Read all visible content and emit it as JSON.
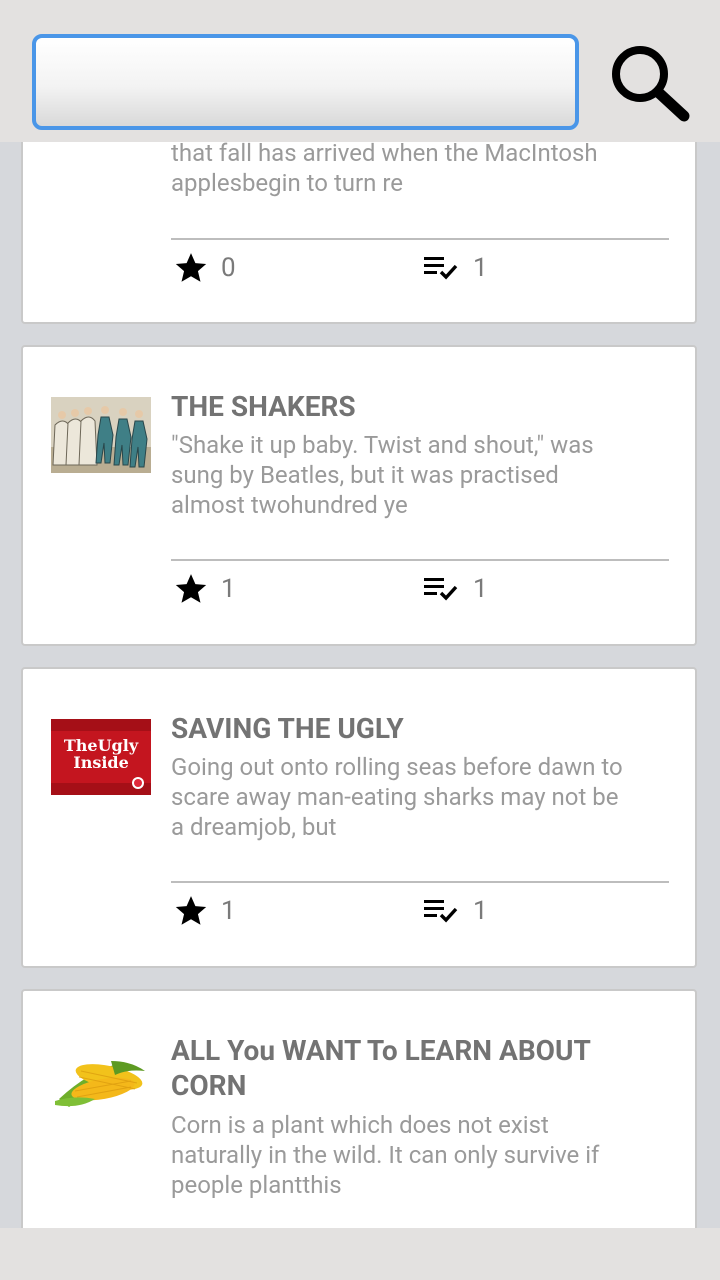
{
  "search": {
    "placeholder": "",
    "value": ""
  },
  "articles": [
    {
      "title": "",
      "description_line1": "that fall has arrived when the MacIntosh",
      "description_line2": "applesbegin to turn re",
      "description_line3": "",
      "stars": "0",
      "checks": "1"
    },
    {
      "title": "THE SHAKERS",
      "thumbnail": "shakers-engraving-image",
      "description_line1": "\"Shake it up baby. Twist and shout,\" was",
      "description_line2": "sung by Beatles, but it was practised",
      "description_line3": "almost twohundred ye",
      "stars": "1",
      "checks": "1"
    },
    {
      "title": "SAVING THE UGLY",
      "thumbnail": "the-ugly-inside-image",
      "thumb_text_1": "TheUgly",
      "thumb_text_2": "Inside",
      "description_line1": "Going out onto rolling seas before dawn to",
      "description_line2": "scare away man-eating sharks may not be",
      "description_line3": "a dreamjob, but",
      "stars": "1",
      "checks": "1"
    },
    {
      "title_line1": "ALL You WANT To LEARN ABOUT",
      "title_line2": "CORN",
      "thumbnail": "corn-cobs-image",
      "description_line1": "Corn is a plant which does not exist",
      "description_line2": "naturally in the wild. It can only survive if",
      "description_line3": "people plantthis"
    }
  ],
  "icons": {
    "star": "star-icon",
    "checklist": "checklist-icon",
    "search": "search-icon"
  },
  "colors": {
    "accent": "#4a96e8",
    "title": "#737373",
    "description": "#9a9a9a",
    "background": "#d6d8dc"
  }
}
